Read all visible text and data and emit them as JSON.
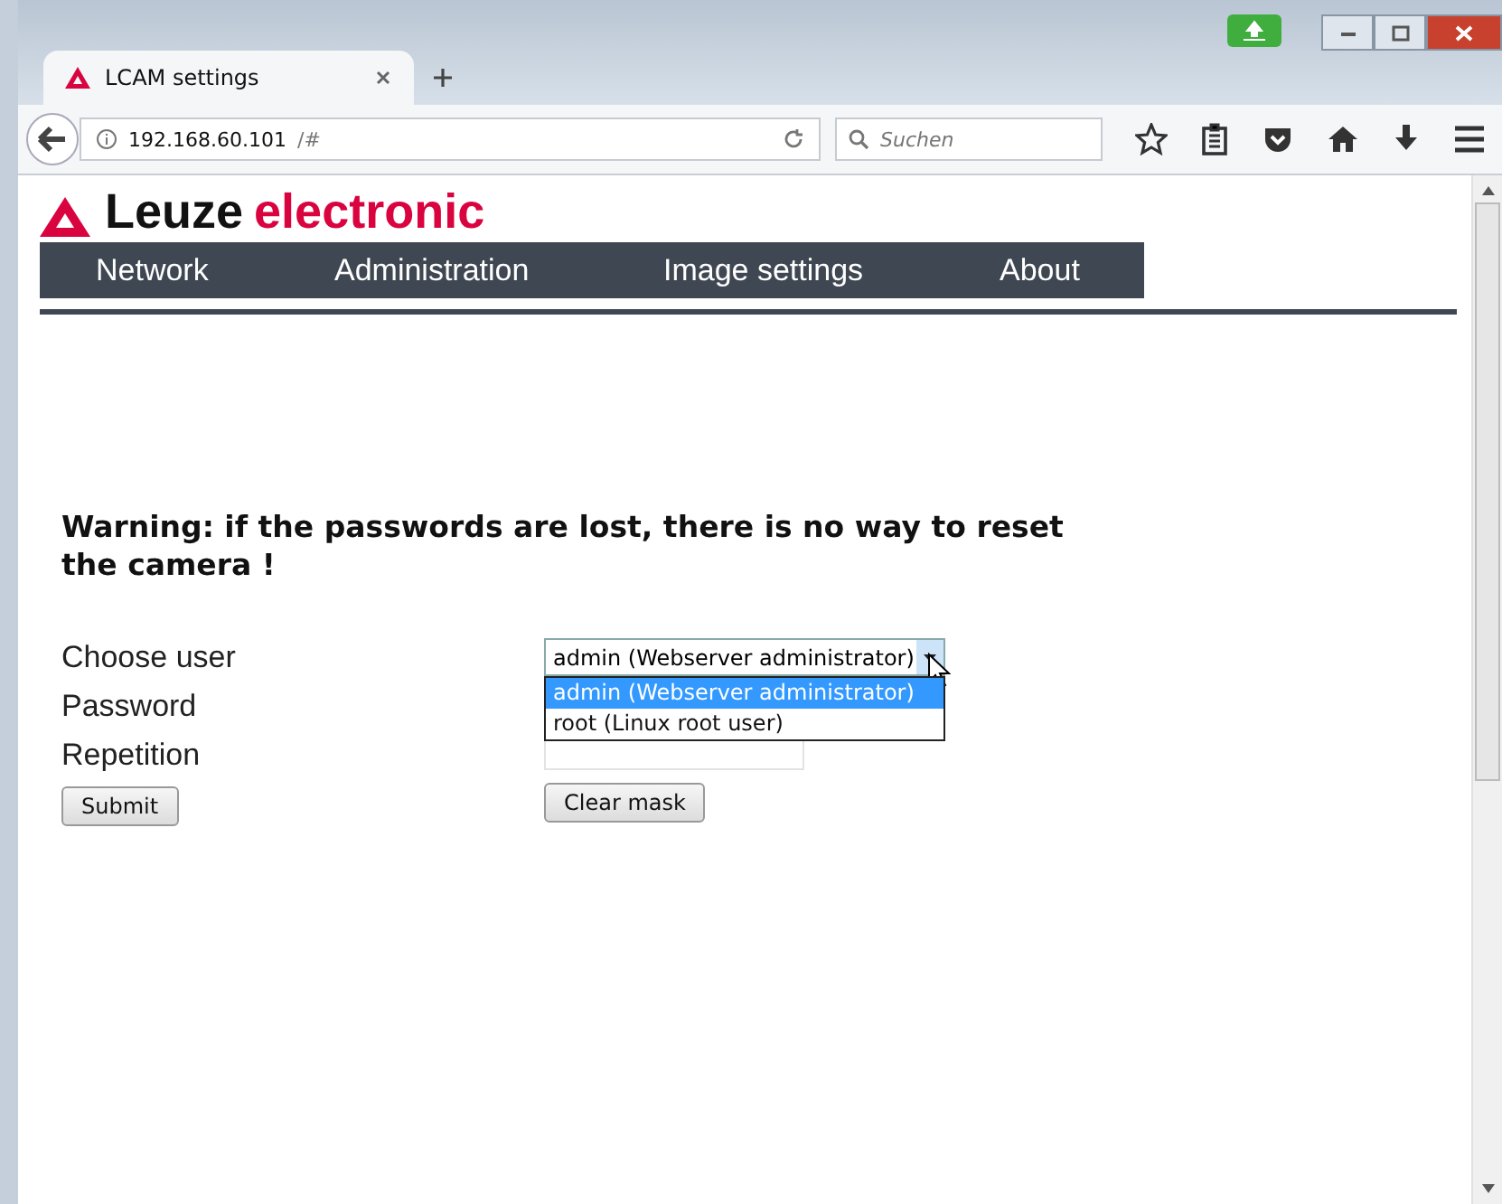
{
  "tabs": [
    {
      "label": "LCAM settings",
      "selected": true
    }
  ],
  "address": {
    "host": "192.168.60.101",
    "path": "/#"
  },
  "search": {
    "placeholder": "Suchen"
  },
  "logo": {
    "brand": "Leuze",
    "suffix": "electronic"
  },
  "nav": [
    {
      "label": "Network"
    },
    {
      "label": "Administration"
    },
    {
      "label": "Image settings"
    },
    {
      "label": "About"
    }
  ],
  "warning": "Warning: if the passwords are lost, there is no way to reset the camera !",
  "form": {
    "labels": [
      "Choose user",
      "Password",
      "Repetition"
    ],
    "select": {
      "value": "admin (Webserver administrator)",
      "expanded": true,
      "options": [
        {
          "label": "admin (Webserver administrator)",
          "selected": true
        },
        {
          "label": "root (Linux root user)",
          "selected": false
        }
      ]
    },
    "buttons": [
      "Submit",
      "Clear mask"
    ]
  }
}
